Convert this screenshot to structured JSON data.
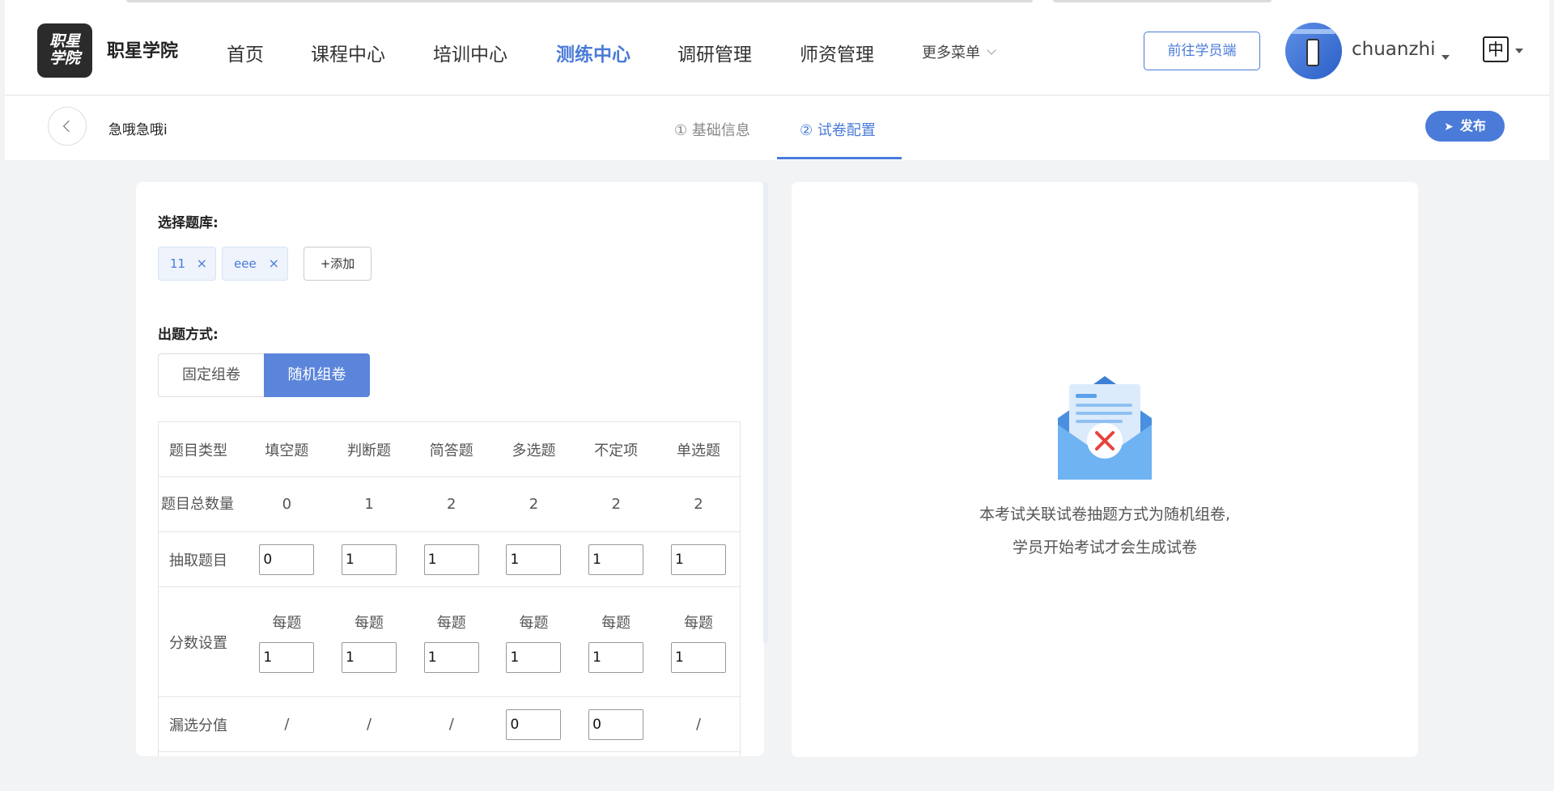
{
  "header": {
    "logo_text": "职星学院",
    "brand": "职星学院",
    "nav": [
      {
        "label": "首页"
      },
      {
        "label": "课程中心"
      },
      {
        "label": "培训中心"
      },
      {
        "label": "测练中心"
      },
      {
        "label": "调研管理"
      },
      {
        "label": "师资管理"
      }
    ],
    "more_menu": "更多菜单",
    "goto_student": "前往学员端",
    "username": "chuanzhi",
    "lang": "中"
  },
  "subheader": {
    "title": "急哦急哦i",
    "steps": [
      {
        "label": "① 基础信息"
      },
      {
        "label": "② 试卷配置"
      }
    ],
    "publish": "发布"
  },
  "form": {
    "bank_label": "选择题库:",
    "banks": [
      {
        "name": "11",
        "remove": "×"
      },
      {
        "name": "eee",
        "remove": "×"
      }
    ],
    "add_label": "+添加",
    "mode_label": "出题方式:",
    "modes": [
      "固定组卷",
      "随机组卷"
    ],
    "table": {
      "row_labels": [
        "题目类型",
        "题目总数量",
        "抽取题目",
        "分数设置",
        "漏选分值"
      ],
      "types": [
        "填空题",
        "判断题",
        "简答题",
        "多选题",
        "不定项",
        "单选题"
      ],
      "totals": [
        "0",
        "1",
        "2",
        "2",
        "2",
        "2"
      ],
      "draw": [
        "0",
        "1",
        "1",
        "1",
        "1",
        "1"
      ],
      "score_prefix": "每题",
      "scores": [
        "1",
        "1",
        "1",
        "1",
        "1",
        "1"
      ],
      "partial": [
        "/",
        "/",
        "/",
        "0",
        "0",
        "/"
      ]
    }
  },
  "empty": {
    "line1": "本考试关联试卷抽题方式为随机组卷,",
    "line2": "学员开始考试才会生成试卷"
  }
}
